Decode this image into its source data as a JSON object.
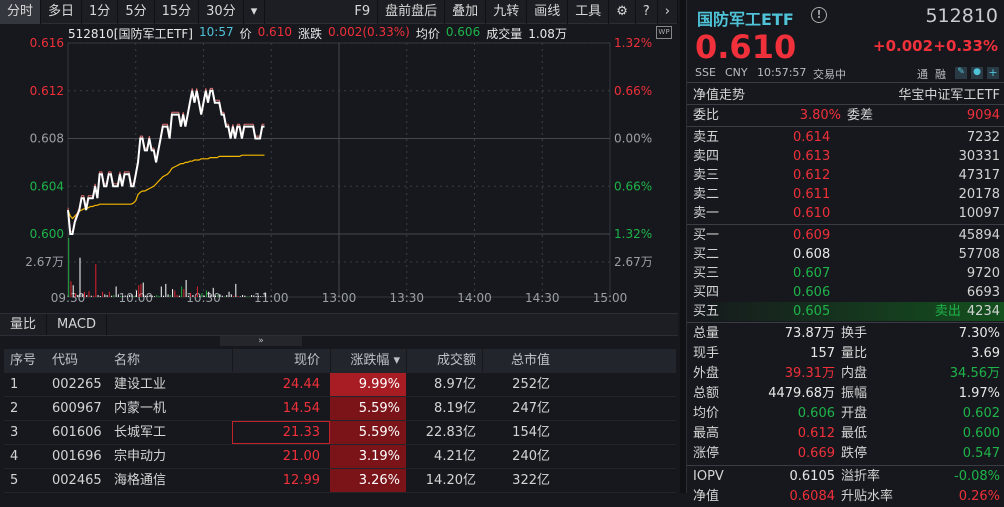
{
  "toolbar": {
    "left_tabs": [
      "分时",
      "多日",
      "1分",
      "5分",
      "15分",
      "30分"
    ],
    "more": "▾",
    "right_tools": [
      "F9",
      "盘前盘后",
      "叠加",
      "九转",
      "画线",
      "工具"
    ],
    "settings": "⚙",
    "help": "?",
    "next": "›"
  },
  "chart_header": {
    "title": "512810[国防军工ETF]",
    "time": "10:57",
    "price_label": "价",
    "price": "0.610",
    "change_label": "涨跌",
    "change": "0.002(0.33%)",
    "avg_label": "均价",
    "avg": "0.606",
    "volume_label": "成交量",
    "volume": "1.08万",
    "wp": "WP"
  },
  "chart_data": {
    "type": "line",
    "title": "512810[国防军工ETF]",
    "y_ticks": [
      "0.616",
      "0.612",
      "0.608",
      "0.604",
      "0.600"
    ],
    "y_range": [
      0.6,
      0.616
    ],
    "pct_ticks": [
      "1.32%",
      "0.66%",
      "0.00%",
      "0.66%",
      "1.32%"
    ],
    "x_ticks": [
      "09:30",
      "10:00",
      "10:30",
      "11:00",
      "13:00",
      "13:30",
      "14:00",
      "14:30",
      "15:00"
    ],
    "volume_label": "2.67万",
    "price": [
      0.602,
      0.6,
      0.6,
      0.601,
      0.6015,
      0.602,
      0.603,
      0.603,
      0.602,
      0.603,
      0.603,
      0.603,
      0.604,
      0.603,
      0.605,
      0.605,
      0.604,
      0.604,
      0.605,
      0.605,
      0.604,
      0.604,
      0.604,
      0.605,
      0.604,
      0.605,
      0.605,
      0.605,
      0.604,
      0.604,
      0.605,
      0.606,
      0.608,
      0.608,
      0.607,
      0.607,
      0.608,
      0.607,
      0.607,
      0.606,
      0.607,
      0.608,
      0.609,
      0.609,
      0.609,
      0.608,
      0.61,
      0.61,
      0.61,
      0.61,
      0.609,
      0.61,
      0.609,
      0.61,
      0.611,
      0.612,
      0.611,
      0.612,
      0.611,
      0.61,
      0.611,
      0.612,
      0.611,
      0.612,
      0.612,
      0.611,
      0.611,
      0.611,
      0.61,
      0.61,
      0.609,
      0.609,
      0.608,
      0.609,
      0.608,
      0.609,
      0.609,
      0.608,
      0.609,
      0.609,
      0.609,
      0.609,
      0.609,
      0.608,
      0.608,
      0.608,
      0.609,
      0.609
    ],
    "avg": [
      0.602,
      0.6015,
      0.6013,
      0.6015,
      0.6017,
      0.6019,
      0.602,
      0.6021,
      0.6021,
      0.6022,
      0.6023,
      0.6023,
      0.6024,
      0.6024,
      0.6025,
      0.6025,
      0.6025,
      0.6025,
      0.6025,
      0.6025,
      0.6025,
      0.6025,
      0.6025,
      0.6025,
      0.6025,
      0.6025,
      0.6025,
      0.6025,
      0.6025,
      0.6026,
      0.6028,
      0.6033,
      0.6035,
      0.6036,
      0.6036,
      0.6037,
      0.6038,
      0.6039,
      0.604,
      0.6042,
      0.6044,
      0.6046,
      0.6048,
      0.6049,
      0.605,
      0.6052,
      0.6055,
      0.6056,
      0.6057,
      0.6058,
      0.6059,
      0.6059,
      0.606,
      0.606,
      0.6061,
      0.6061,
      0.6062,
      0.6062,
      0.6062,
      0.6063,
      0.6063,
      0.6063,
      0.6063,
      0.6064,
      0.6064,
      0.6064,
      0.6064,
      0.6065,
      0.6065,
      0.6065,
      0.6065,
      0.6065,
      0.6065,
      0.6065,
      0.6065,
      0.6065,
      0.6065,
      0.6066,
      0.6066,
      0.6066,
      0.6066,
      0.6066,
      0.6066,
      0.6066,
      0.6066,
      0.6066,
      0.6066,
      0.6066
    ],
    "volume": [
      45000,
      12000,
      9000,
      3000,
      1500,
      30000,
      2000,
      4000,
      1500,
      4500,
      1000,
      1000,
      25000,
      1500,
      800,
      4000,
      2000,
      1500,
      4000,
      1000,
      1500,
      8000,
      2000,
      800,
      700,
      1200,
      700,
      1600,
      2000,
      800,
      5000,
      9000,
      10000,
      11000,
      1000,
      800,
      1500,
      1000,
      600,
      1500,
      800,
      8000,
      1000,
      10000,
      2000,
      1500,
      6000,
      5000,
      1500,
      1000,
      8000,
      6000,
      13000,
      1000,
      3000,
      1500,
      1000,
      8000,
      1000,
      3000,
      1000,
      5000,
      4000,
      1500,
      7000,
      1000,
      1500,
      2000,
      1000,
      500,
      1500,
      4000,
      2000,
      1000,
      10000,
      800,
      500,
      1500,
      1000,
      500,
      500,
      1500,
      1200,
      700,
      800,
      600,
      500,
      3500
    ],
    "volume_dir": [
      "g",
      "r",
      "w",
      "r",
      "w",
      "w",
      "w",
      "r",
      "w",
      "r",
      "w",
      "r",
      "r",
      "w",
      "w",
      "r",
      "w",
      "w",
      "r",
      "w",
      "g",
      "w",
      "w",
      "g",
      "w",
      "w",
      "w",
      "w",
      "w",
      "g",
      "w",
      "r",
      "r",
      "w",
      "w",
      "w",
      "w",
      "w",
      "w",
      "g",
      "g",
      "w",
      "w",
      "w",
      "w",
      "g",
      "w",
      "r",
      "r",
      "w",
      "g",
      "r",
      "w",
      "w",
      "r",
      "w",
      "r",
      "r",
      "w",
      "g",
      "w",
      "g",
      "w",
      "w",
      "w",
      "w",
      "g",
      "w",
      "w",
      "g",
      "w",
      "w",
      "w",
      "r",
      "w",
      "r",
      "w",
      "w",
      "w",
      "g",
      "g",
      "w",
      "w",
      "w",
      "w",
      "w",
      "w",
      "w"
    ],
    "colors": {
      "price": "#ffffff",
      "avg": "#f5b800",
      "up": "#e0202a",
      "down": "#1fa83a"
    }
  },
  "subtabs": [
    "量比",
    "MACD"
  ],
  "collapse": "»",
  "table": {
    "headers": [
      "序号",
      "代码",
      "名称",
      "现价",
      "涨跌幅 ▾",
      "成交额",
      "总市值"
    ],
    "rows": [
      [
        "1",
        "002265",
        "建设工业",
        "24.44",
        "9.99%",
        "8.97亿",
        "252亿"
      ],
      [
        "2",
        "600967",
        "内蒙一机",
        "14.54",
        "5.59%",
        "8.19亿",
        "247亿"
      ],
      [
        "3",
        "601606",
        "长城军工",
        "21.33",
        "5.59%",
        "22.83亿",
        "154亿"
      ],
      [
        "4",
        "001696",
        "宗申动力",
        "21.00",
        "3.19%",
        "4.21亿",
        "240亿"
      ],
      [
        "5",
        "002465",
        "海格通信",
        "12.99",
        "3.26%",
        "14.20亿",
        "322亿"
      ]
    ]
  },
  "quote": {
    "name": "国防军工ETF",
    "info_icon": "!",
    "code": "512810",
    "price": "0.610",
    "change": "+0.002",
    "change_pct": "+0.33%",
    "exchange": "SSE",
    "currency": "CNY",
    "time": "10:57:57",
    "status": "交易中",
    "tong": "通",
    "rong": "融",
    "nav_trend": "净值走势",
    "index_name": "华宝中证军工ETF",
    "weibi_label": "委比",
    "weibi": "3.80%",
    "weicha_label": "委差",
    "weicha": "9094",
    "asks": [
      {
        "label": "卖五",
        "price": "0.614",
        "qty": "7232"
      },
      {
        "label": "卖四",
        "price": "0.613",
        "qty": "30331"
      },
      {
        "label": "卖三",
        "price": "0.612",
        "qty": "47317"
      },
      {
        "label": "卖二",
        "price": "0.611",
        "qty": "20178"
      },
      {
        "label": "卖一",
        "price": "0.610",
        "qty": "10097"
      }
    ],
    "bids": [
      {
        "label": "买一",
        "price": "0.609",
        "qty": "45894"
      },
      {
        "label": "买二",
        "price": "0.608",
        "qty": "57708"
      },
      {
        "label": "买三",
        "price": "0.607",
        "qty": "9720"
      },
      {
        "label": "买四",
        "price": "0.606",
        "qty": "6693"
      },
      {
        "label": "买五",
        "price": "0.605",
        "qty": "4234",
        "tag": "卖出"
      }
    ],
    "stats": [
      [
        "总量",
        "73.87万",
        "换手",
        "7.30%"
      ],
      [
        "现手",
        "157",
        "量比",
        "3.69"
      ],
      [
        "外盘",
        "39.31万",
        "内盘",
        "34.56万"
      ],
      [
        "总额",
        "4479.68万",
        "振幅",
        "1.97%"
      ],
      [
        "均价",
        "0.606",
        "开盘",
        "0.602"
      ],
      [
        "最高",
        "0.612",
        "最低",
        "0.600"
      ],
      [
        "涨停",
        "0.669",
        "跌停",
        "0.547"
      ]
    ],
    "iopv": [
      [
        "IOPV",
        "0.6105",
        "溢折率",
        "-0.08%"
      ],
      [
        "净值",
        "0.6084",
        "升贴水率",
        "0.26%"
      ]
    ]
  }
}
